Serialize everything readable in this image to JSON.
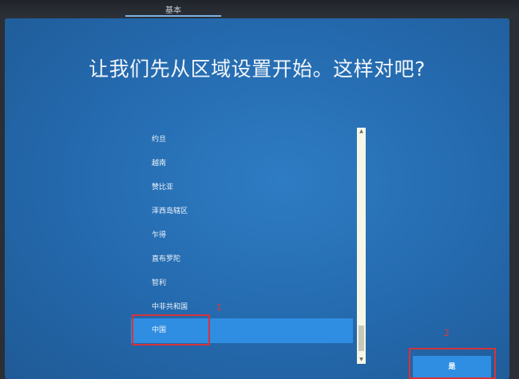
{
  "tab": {
    "label": "基本"
  },
  "title": "让我们先从区域设置开始。这样对吧?",
  "regions": [
    {
      "label": "约旦"
    },
    {
      "label": "越南"
    },
    {
      "label": "赞比亚"
    },
    {
      "label": "泽西岛辖区"
    },
    {
      "label": "乍得"
    },
    {
      "label": "直布罗陀"
    },
    {
      "label": "智利"
    },
    {
      "label": "中非共和国"
    },
    {
      "label": "中国",
      "selected": true
    }
  ],
  "annotations": {
    "marker1": "1",
    "marker2": "2"
  },
  "buttons": {
    "yes": "是"
  },
  "colors": {
    "accent": "#2f8ee2",
    "annotation": "#d6333a"
  }
}
